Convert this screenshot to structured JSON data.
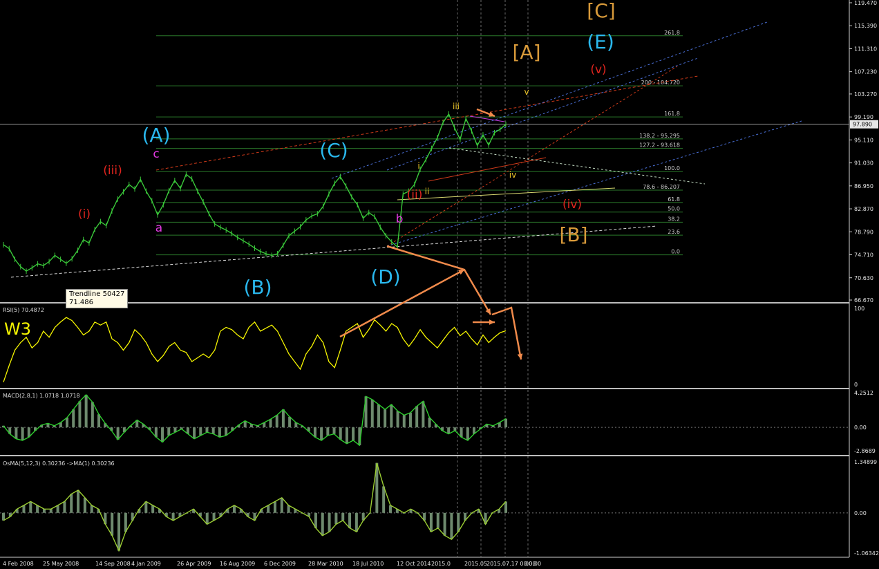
{
  "colors": {
    "background": "#000000",
    "price_bar": "#3ac83a",
    "rsi_line": "#f5f500",
    "macd_line": "#2ecc2e",
    "osma_line": "#9acd32",
    "histogram": "#6e8a6e",
    "fib_line": "#2b7a2b",
    "trend_blue": "#4a6fd6",
    "trend_red": "#d23b1a",
    "annotation_arrow": "#f08a4b"
  },
  "chart_data": [
    {
      "type": "line",
      "panel": "price",
      "ylim": [
        66.67,
        119.47
      ],
      "yticks": [
        "119.470",
        "115.390",
        "111.310",
        "107.230",
        "103.270",
        "99.190",
        "95.110",
        "91.030",
        "86.950",
        "82.870",
        "78.790",
        "74.710",
        "70.630",
        "66.670"
      ],
      "current_price": "97.890",
      "xticks": [
        "4 Feb 2008",
        "25 May 2008",
        "14 Sep 2008",
        "4 Jan 2009",
        "26 Apr 2009",
        "16 Aug 2009",
        "6 Dec 2009",
        "28 Mar 2010",
        "18 Jul 2010",
        "12 Oct 2014",
        "2015.0",
        "2015.05",
        "2015.07.17 00:00",
        "00:00"
      ],
      "series": [
        {
          "values": [
            76.5,
            75.8,
            73.9,
            72.6,
            71.8,
            72.4,
            73.1,
            72.8,
            73.5,
            74.6,
            73.9,
            73.2,
            74.0,
            75.5,
            77.4,
            76.8,
            79.2,
            80.6,
            79.9,
            82.5,
            84.6,
            85.9,
            87.2,
            86.4,
            88.1,
            86.0,
            84.3,
            81.8,
            83.6,
            86.1,
            87.9,
            86.5,
            89.0,
            88.2,
            86.0,
            84.1,
            82.0,
            80.2,
            79.6,
            79.1,
            78.5,
            77.8,
            77.2,
            76.6,
            75.9,
            75.3,
            74.9,
            74.6,
            74.9,
            76.4,
            78.1,
            78.9,
            79.7,
            80.9,
            81.6,
            82.0,
            83.3,
            85.5,
            87.4,
            88.6,
            86.9,
            85.0,
            83.6,
            81.2,
            82.2,
            81.5,
            79.6,
            78.1,
            77.0,
            76.1,
            85.5,
            86.0,
            87.2,
            89.9,
            91.6,
            93.6,
            95.5,
            98.2,
            99.7,
            97.3,
            95.2,
            98.9,
            96.7,
            94.1,
            96.0,
            94.2,
            96.4,
            97.0,
            97.89
          ]
        }
      ],
      "fib_levels": [
        {
          "label": "261.8",
          "value": 113.6
        },
        {
          "label": "200 - 104.720",
          "value": 104.72
        },
        {
          "label": "161.8",
          "value": 99.2
        },
        {
          "label": "138.2 - 95.295",
          "value": 95.3
        },
        {
          "label": "127.2 - 93.618",
          "value": 93.6
        },
        {
          "label": "100.0",
          "value": 89.5
        },
        {
          "label": "78.6 - 86.207",
          "value": 86.2
        },
        {
          "label": "61.8",
          "value": 84.0
        },
        {
          "label": "50.0",
          "value": 82.3
        },
        {
          "label": "38.2",
          "value": 80.5
        },
        {
          "label": "23.6",
          "value": 78.2
        },
        {
          "label": "0.0",
          "value": 74.7
        }
      ],
      "wave_labels": [
        {
          "text": "(A)",
          "color": "#2ab8ee",
          "size": "big"
        },
        {
          "text": "(B)",
          "color": "#2ab8ee",
          "size": "big"
        },
        {
          "text": "(C)",
          "color": "#2ab8ee",
          "size": "big"
        },
        {
          "text": "(D)",
          "color": "#2ab8ee",
          "size": "big"
        },
        {
          "text": "(E)",
          "color": "#2ab8ee",
          "size": "big"
        },
        {
          "text": "[A]",
          "color": "#d89a3a",
          "size": "big"
        },
        {
          "text": "[B]",
          "color": "#d89a3a",
          "size": "big"
        },
        {
          "text": "[C]",
          "color": "#d89a3a",
          "size": "big"
        },
        {
          "text": "a",
          "color": "#e23ae2",
          "size": "mid"
        },
        {
          "text": "b",
          "color": "#e23ae2",
          "size": "mid"
        },
        {
          "text": "c",
          "color": "#e23ae2",
          "size": "mid"
        },
        {
          "text": "(i)",
          "color": "#e0241e",
          "size": "mid"
        },
        {
          "text": "(ii)",
          "color": "#e0241e",
          "size": "mid"
        },
        {
          "text": "(iii)",
          "color": "#e0241e",
          "size": "mid"
        },
        {
          "text": "(iv)",
          "color": "#e0241e",
          "size": "mid"
        },
        {
          "text": "(v)",
          "color": "#e0241e",
          "size": "mid"
        },
        {
          "text": "i",
          "color": "#e8c228",
          "size": "small"
        },
        {
          "text": "ii",
          "color": "#e8c228",
          "size": "small"
        },
        {
          "text": "iii",
          "color": "#e8c228",
          "size": "small"
        },
        {
          "text": "iv",
          "color": "#e8c228",
          "size": "small"
        },
        {
          "text": "v",
          "color": "#e8c228",
          "size": "small"
        }
      ],
      "tooltip": {
        "line1": "Trendline 50427",
        "line2": "71.486"
      }
    },
    {
      "type": "line",
      "panel": "rsi",
      "title": "RSI(5) 70.4872",
      "ylim": [
        0,
        100
      ],
      "yticks": [
        "100",
        "0"
      ],
      "annotation": "W3",
      "series": [
        {
          "values": [
            3,
            25,
            45,
            55,
            62,
            48,
            55,
            70,
            62,
            75,
            82,
            88,
            84,
            75,
            65,
            70,
            82,
            78,
            82,
            60,
            55,
            45,
            55,
            72,
            65,
            55,
            40,
            30,
            38,
            50,
            55,
            45,
            42,
            30,
            35,
            40,
            35,
            45,
            70,
            75,
            72,
            65,
            60,
            75,
            82,
            70,
            74,
            78,
            70,
            55,
            40,
            30,
            20,
            40,
            50,
            65,
            55,
            30,
            22,
            45,
            70,
            75,
            80,
            62,
            72,
            85,
            78,
            70,
            80,
            75,
            60,
            50,
            60,
            72,
            62,
            55,
            48,
            58,
            68,
            75,
            64,
            70,
            60,
            52,
            65,
            55,
            62,
            68,
            70.5
          ]
        }
      ]
    },
    {
      "type": "bar",
      "panel": "macd",
      "title": "MACD(2,8,1) 1.0718 1.0718",
      "ylim": [
        -2.8689,
        4.2512
      ],
      "yticks": [
        "4.2512",
        "0.00",
        "-2.8689"
      ],
      "series": [
        {
          "values": [
            0.2,
            -0.8,
            -1.4,
            -1.6,
            -1.2,
            -0.4,
            0.3,
            0.5,
            0.2,
            0.6,
            1.2,
            2.2,
            3.2,
            4.0,
            3.1,
            1.6,
            0.5,
            -0.4,
            -1.5,
            -0.6,
            0.2,
            0.9,
            0.4,
            -0.3,
            -1.2,
            -1.8,
            -1.0,
            -0.6,
            -0.2,
            -0.8,
            -1.4,
            -1.0,
            -0.6,
            -0.8,
            -1.2,
            -1.0,
            -0.4,
            0.3,
            0.8,
            0.4,
            0.2,
            0.6,
            1.0,
            1.5,
            2.2,
            1.3,
            0.6,
            0.2,
            -0.5,
            -1.2,
            -1.6,
            -1.0,
            -0.8,
            -1.5,
            -2.0,
            -1.6,
            -2.2,
            3.8,
            3.4,
            2.8,
            2.2,
            2.8,
            2.0,
            1.5,
            1.8,
            2.6,
            3.2,
            1.2,
            0.4,
            -0.4,
            -0.8,
            -0.4,
            -1.2,
            -1.6,
            -0.8,
            -0.2,
            0.4,
            0.2,
            0.6,
            1.07
          ]
        }
      ]
    },
    {
      "type": "bar",
      "panel": "osma",
      "title": "OsMA(5,12,3) 0.30236  ->MA(1) 0.30236",
      "ylim": [
        -1.06342,
        1.34899
      ],
      "yticks": [
        "1.34899",
        "0.00",
        "-1.06342"
      ],
      "series": [
        {
          "values": [
            -0.2,
            -0.1,
            0.1,
            0.2,
            0.3,
            0.2,
            0.1,
            0.1,
            0.2,
            0.3,
            0.5,
            0.6,
            0.4,
            0.2,
            0.1,
            -0.3,
            -0.6,
            -1.0,
            -0.5,
            -0.2,
            0.1,
            0.3,
            0.2,
            0.1,
            -0.1,
            -0.2,
            -0.1,
            0.0,
            0.1,
            -0.1,
            -0.3,
            -0.2,
            -0.1,
            0.1,
            0.2,
            0.1,
            -0.1,
            -0.2,
            0.1,
            0.2,
            0.3,
            0.4,
            0.2,
            0.1,
            0.0,
            -0.1,
            -0.4,
            -0.6,
            -0.5,
            -0.3,
            -0.2,
            -0.4,
            -0.5,
            -0.2,
            0.0,
            1.32,
            0.7,
            0.2,
            0.1,
            0.0,
            0.1,
            0.0,
            -0.2,
            -0.5,
            -0.4,
            -0.6,
            -0.7,
            -0.5,
            -0.2,
            0.0,
            0.1,
            -0.3,
            0.0,
            0.1,
            0.3
          ]
        }
      ]
    }
  ]
}
